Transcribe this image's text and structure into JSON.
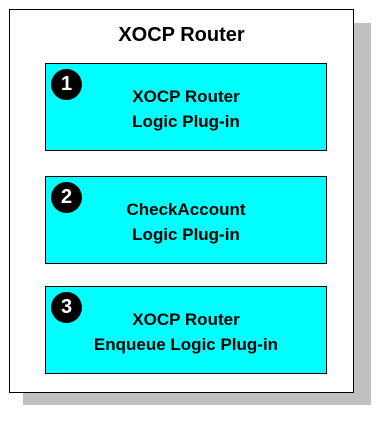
{
  "router": {
    "title": "XOCP Router"
  },
  "plugins": [
    {
      "number": "1",
      "line1": "XOCP Router",
      "line2": "Logic Plug-in"
    },
    {
      "number": "2",
      "line1": "CheckAccount",
      "line2": "Logic Plug-in"
    },
    {
      "number": "3",
      "line1": "XOCP Router",
      "line2": "Enqueue Logic Plug-in"
    }
  ],
  "colors": {
    "plugin_fill": "#00ffff",
    "shadow": "#c0c0c0",
    "badge": "#000000"
  }
}
